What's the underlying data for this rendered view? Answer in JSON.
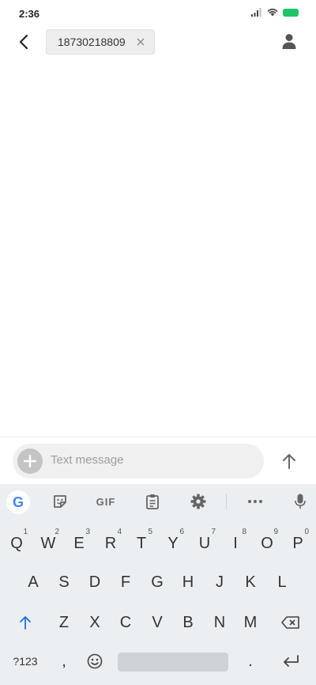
{
  "status_bar": {
    "time": "2:36"
  },
  "header": {
    "recipient": "18730218809"
  },
  "compose": {
    "placeholder": "Text message"
  },
  "keyboard": {
    "toolbar": {
      "google_label": "G",
      "gif_label": "GIF"
    },
    "row1": [
      {
        "letter": "Q",
        "hint": "1"
      },
      {
        "letter": "W",
        "hint": "2"
      },
      {
        "letter": "E",
        "hint": "3"
      },
      {
        "letter": "R",
        "hint": "4"
      },
      {
        "letter": "T",
        "hint": "5"
      },
      {
        "letter": "Y",
        "hint": "6"
      },
      {
        "letter": "U",
        "hint": "7"
      },
      {
        "letter": "I",
        "hint": "8"
      },
      {
        "letter": "O",
        "hint": "9"
      },
      {
        "letter": "P",
        "hint": "0"
      }
    ],
    "row2": [
      "A",
      "S",
      "D",
      "F",
      "G",
      "H",
      "J",
      "K",
      "L"
    ],
    "row3": [
      "Z",
      "X",
      "C",
      "V",
      "B",
      "N",
      "M"
    ],
    "symbols_label": "?123",
    "comma_label": ",",
    "period_label": ".",
    "colors": {
      "shift_accent": "#1a73e8",
      "battery": "#1fc46a"
    }
  }
}
